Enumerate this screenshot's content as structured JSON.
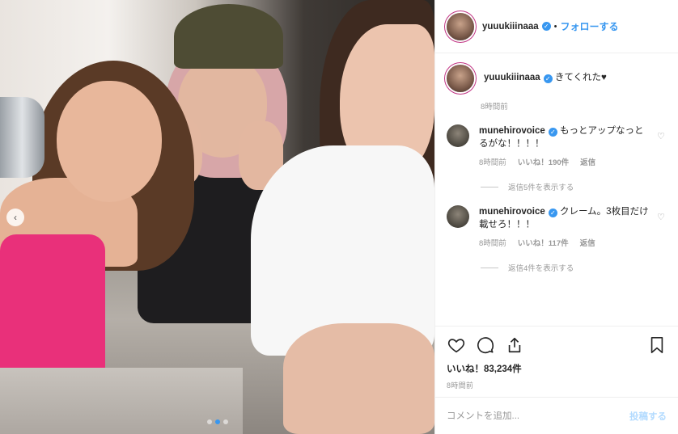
{
  "header": {
    "username": "yuuukiiinaaa",
    "separator": "•",
    "follow_label": "フォローする"
  },
  "caption": {
    "username": "yuuukiiinaaa",
    "text": "きてくれた♥",
    "time": "8時間前"
  },
  "comments": [
    {
      "username": "munehirovoice",
      "text": "もっとアップなっとるがな！！！！",
      "time": "8時間前",
      "likes": "いいね！190件",
      "reply_label": "返信",
      "view_replies": "返信5件を表示する"
    },
    {
      "username": "munehirovoice",
      "text": "クレーム。3枚目だけ載せろ！！！",
      "time": "8時間前",
      "likes": "いいね！117件",
      "reply_label": "返信",
      "view_replies": "返信4件を表示する"
    }
  ],
  "actions": {
    "likes": "いいね！83,234件",
    "time": "8時間前"
  },
  "composer": {
    "placeholder": "コメントを追加...",
    "post_label": "投稿する"
  },
  "carousel": {
    "current_slide": 2,
    "total_slides": 3
  },
  "colors": {
    "accent": "#3897f0",
    "text": "#262626",
    "muted": "#999999",
    "post_disabled": "#b3dbff"
  }
}
